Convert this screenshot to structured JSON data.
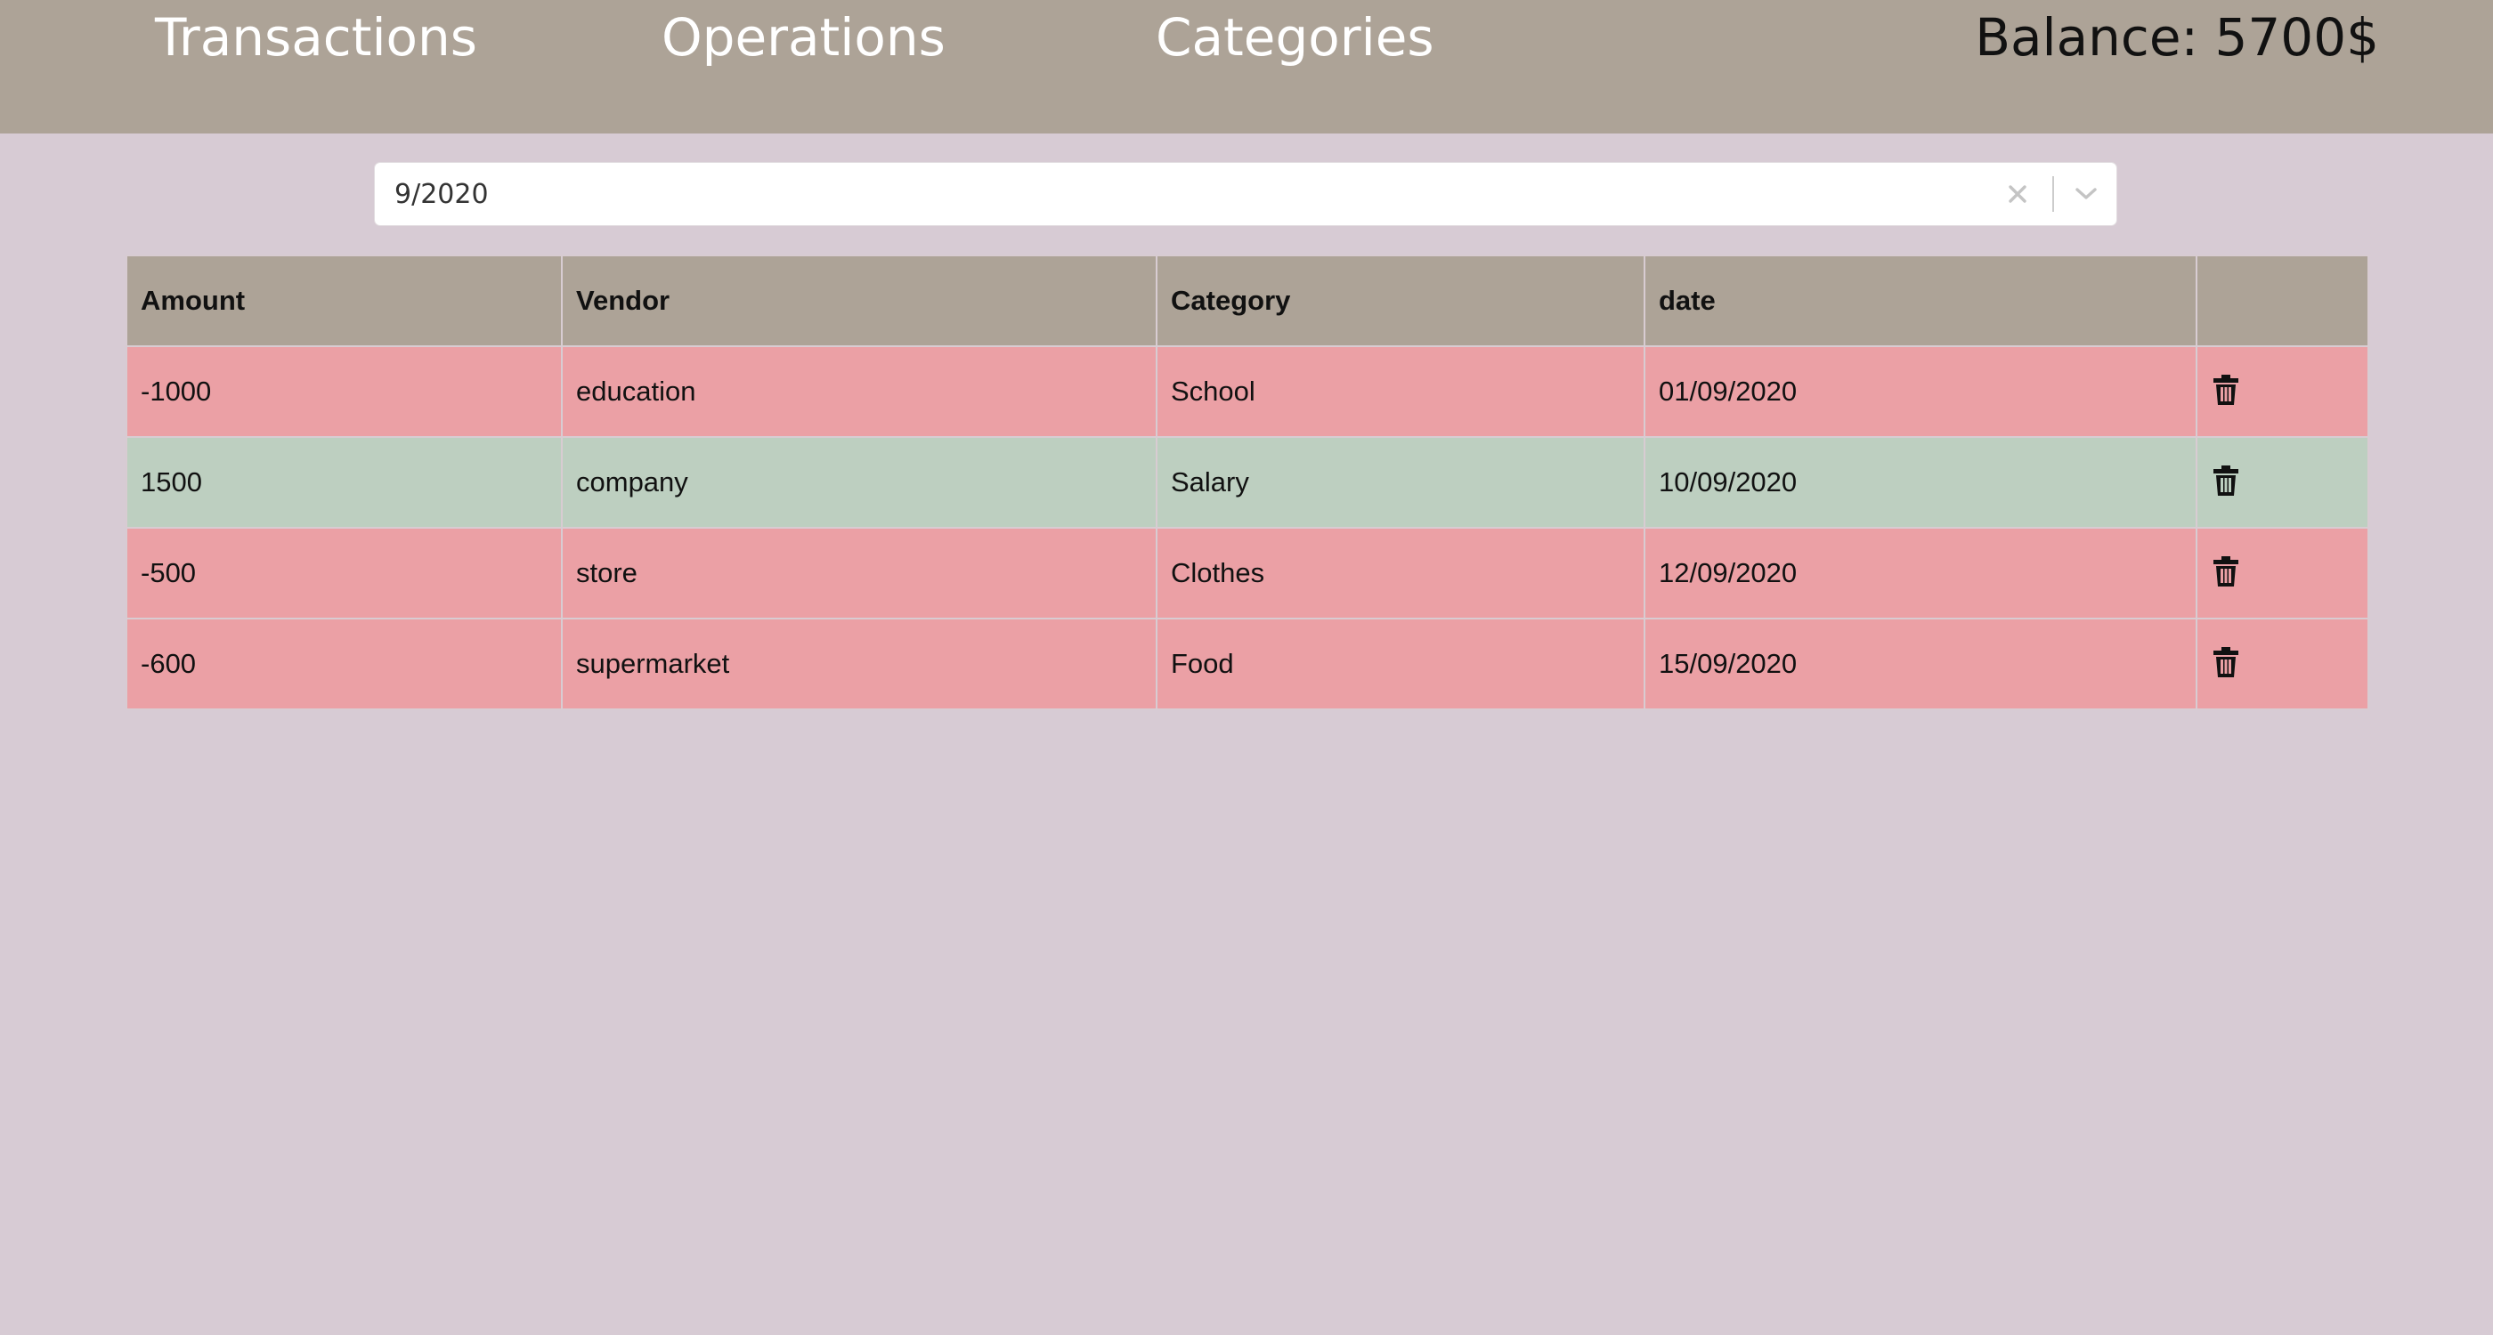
{
  "nav": {
    "transactions": "Transactions",
    "operations": "Operations",
    "categories": "Categories",
    "balance": "Balance: 5700$"
  },
  "filter": {
    "month_value": "9/2020",
    "clear_icon": "close-icon",
    "dropdown_icon": "chevron-down-icon"
  },
  "table": {
    "headers": {
      "amount": "Amount",
      "vendor": "Vendor",
      "category": "Category",
      "date": "date",
      "actions": ""
    },
    "rows": [
      {
        "amount": "-1000",
        "vendor": "education",
        "category": "School",
        "date": "01/09/2020",
        "type": "expense"
      },
      {
        "amount": "1500",
        "vendor": "company",
        "category": "Salary",
        "date": "10/09/2020",
        "type": "income"
      },
      {
        "amount": "-500",
        "vendor": "store",
        "category": "Clothes",
        "date": "12/09/2020",
        "type": "expense"
      },
      {
        "amount": "-600",
        "vendor": "supermarket",
        "category": "Food",
        "date": "15/09/2020",
        "type": "expense"
      }
    ],
    "delete_icon": "trash-icon"
  },
  "colors": {
    "navbar": "#ada397",
    "background": "#d7cbd4",
    "expense_row": "#eba0a5",
    "income_row": "#bdcfc0"
  }
}
